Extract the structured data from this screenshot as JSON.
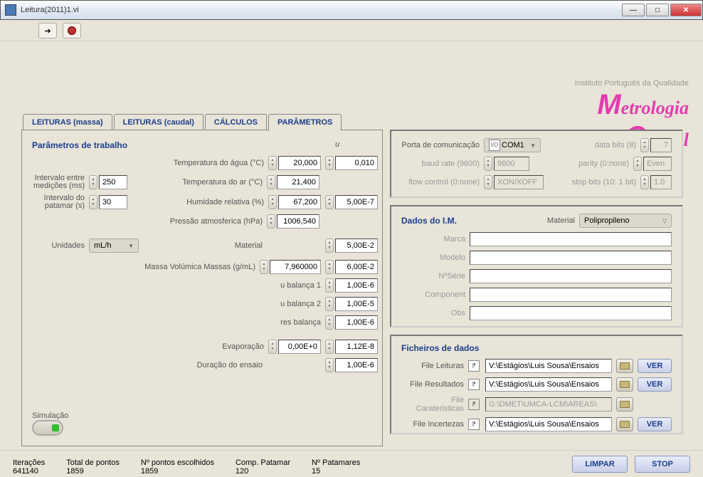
{
  "window": {
    "title": "Leitura(2011)1.vi"
  },
  "tabs": {
    "t0": "LEITURAS (massa)",
    "t1": "LEITURAS (caudal)",
    "t2": "CÁLCULOS",
    "t3": "PARÂMETROS"
  },
  "logo": {
    "inst": "Instituto Português da Qualidade",
    "brand1": "Metrologia",
    "brand2": "µCaudal"
  },
  "params": {
    "title": "Parâmetros de trabalho",
    "u_header": "u",
    "temp_agua_lbl": "Temperatura do água (°C)",
    "temp_agua": "20,000",
    "temp_agua_u": "0,010",
    "intervalo_med_lbl": "Intervalo entre medições (ms)",
    "intervalo_med": "250",
    "temp_ar_lbl": "Temperatura do ar (°C)",
    "temp_ar": "21,400",
    "intervalo_pat_lbl": "Intervalo do patamar (s)",
    "intervalo_pat": "30",
    "humidade_lbl": "Humidade relativa (%)",
    "humidade": "67,200",
    "humidade_u": "5,00E-7",
    "pressao_lbl": "Pressão atmosferica (hPa)",
    "pressao": "1006,540",
    "unidades_lbl": "Unidades",
    "unidades": "mL/h",
    "material_lbl": "Material",
    "material_u": "5,00E-2",
    "massa_vol_lbl": "Massa Volúmica Massas (g/mL)",
    "massa_vol": "7,960000",
    "massa_vol_u": "6,00E-2",
    "ubal1_lbl": "u balança 1",
    "ubal1_u": "1,00E-6",
    "ubal2_lbl": "u balança 2",
    "ubal2_u": "1,00E-5",
    "resbal_lbl": "res balança",
    "resbal_u": "1,00E-6",
    "evap_lbl": "Evaporação",
    "evap": "0,00E+0",
    "evap_u": "1,12E-8",
    "dur_lbl": "Duração do ensaio",
    "dur_u": "1,00E-6",
    "sim_lbl": "Simulação"
  },
  "comm": {
    "porta_lbl": "Porta de comunicação",
    "porta": "COM1",
    "baud_lbl": "baud rate (9600)",
    "baud": "9600",
    "flow_lbl": "flow control (0:none)",
    "flow": "XON/XOFF",
    "databits_lbl": "data bits (8)",
    "databits": "7",
    "parity_lbl": "parity (0:none)",
    "parity": "Even",
    "stopbits_lbl": "stop bits (10: 1 bit)",
    "stopbits": "1.0"
  },
  "im": {
    "title": "Dados do I.M.",
    "material_lbl": "Material",
    "material": "Polipropileno",
    "marca_lbl": "Marca",
    "modelo_lbl": "Modelo",
    "nserie_lbl": "NºSérie",
    "component_lbl": "Component",
    "obs_lbl": "Obs"
  },
  "files": {
    "title": "Ficheiros de dados",
    "leituras_lbl": "File Leituras",
    "leituras": "V:\\Estágios\\Luis Sousa\\Ensaios",
    "resultados_lbl": "File Resultados",
    "resultados": "V:\\Estágios\\Luis Sousa\\Ensaios",
    "carater_lbl": "File Carateristicas",
    "carater": "G:\\DMET\\UMCA-LCM\\AREAS\\",
    "incertezas_lbl": "File Incertezas",
    "incertezas": "V:\\Estágios\\Luis Sousa\\Ensaios",
    "ver": "VER"
  },
  "status": {
    "iter_lbl": "Iterações",
    "iter": "641140",
    "total_lbl": "Total de pontos",
    "total": "1859",
    "escol_lbl": "Nº pontos escolhidos",
    "escol": "1859",
    "comp_lbl": "Comp. Patamar",
    "comp": "120",
    "npat_lbl": "Nº Patamares",
    "npat": "15",
    "limpar": "LIMPAR",
    "stop": "STOP"
  }
}
